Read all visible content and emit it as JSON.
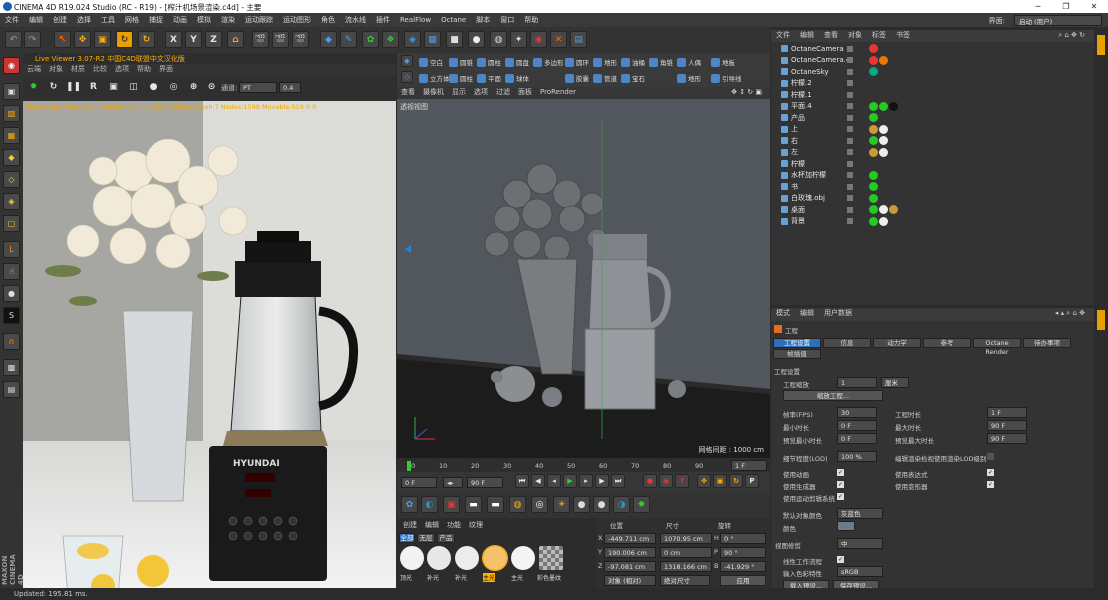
{
  "window": {
    "title": "CINEMA 4D R19.024 Studio (RC - R19) - [榨汁机场景渲染.c4d] - 主要",
    "min": "─",
    "max": "❐",
    "close": "✕"
  },
  "menubar": {
    "items": [
      "文件",
      "编辑",
      "创建",
      "选择",
      "工具",
      "网格",
      "捕捉",
      "动画",
      "模拟",
      "渲染",
      "运动跟踪",
      "运动图形",
      "角色",
      "流水线",
      "插件",
      "RealFlow",
      "Octane",
      "脚本",
      "窗口",
      "帮助"
    ],
    "layout_label": "界面:",
    "layout_value": "启动 (用户)"
  },
  "toolbar": {
    "axes": [
      "X",
      "Y",
      "Z"
    ]
  },
  "live_viewer": {
    "title": "Live Viewer 3.07-R2 中国C4D联盟中文汉化版",
    "menu": [
      "云端",
      "对象",
      "材质",
      "比较",
      "选项",
      "帮助",
      "界面"
    ],
    "channel_label": "通道:",
    "channel_value": "PT",
    "channel_num": "0.4",
    "check_text": "Check:1ms./4ms. MeshGen:6ms. Update[C]:195ms. Mesh:7 Nodes:1598 Movable:519  0 0"
  },
  "primitives": [
    {
      "label": "空白"
    },
    {
      "label": "圆锥"
    },
    {
      "label": "圆柱"
    },
    {
      "label": "圆盘"
    },
    {
      "label": "多边形"
    },
    {
      "label": "圆环"
    },
    {
      "label": "地形"
    },
    {
      "label": "油桶"
    },
    {
      "label": "角锥"
    },
    {
      "label": "人偶"
    },
    {
      "label": "地板"
    },
    {
      "label": "立方体"
    },
    {
      "label": "圆柱"
    },
    {
      "label": "平面"
    },
    {
      "label": "球体"
    },
    {
      "label": "胶囊"
    },
    {
      "label": "管道"
    },
    {
      "label": "宝石"
    },
    {
      "label": "地形"
    },
    {
      "label": "引导线"
    }
  ],
  "viewport": {
    "menu": [
      "查看",
      "摄像机",
      "显示",
      "选项",
      "过滤",
      "面板",
      "ProRender"
    ],
    "label": "透视视图",
    "grid": "网格间距 : 1000 cm"
  },
  "timeline": {
    "ticks": [
      "0",
      "10",
      "20",
      "30",
      "40",
      "50",
      "60",
      "70",
      "80",
      "90"
    ],
    "frame_end": "1 F"
  },
  "transport": {
    "start": "0 F",
    "current": "0 F",
    "end": "90 F",
    "end2": "90 F"
  },
  "materials": {
    "menu": [
      "创建",
      "编辑",
      "功能",
      "纹理"
    ],
    "filters": [
      "全部",
      "无层",
      "产品"
    ],
    "swatches": [
      {
        "label": "顶光",
        "color": "#f2f2f2"
      },
      {
        "label": "补光",
        "color": "#e8e8e8"
      },
      {
        "label": "补光",
        "color": "#ececec"
      },
      {
        "label": "主光",
        "color": "#f5c16b"
      },
      {
        "label": "主光",
        "color": "#f4f4f4"
      },
      {
        "label": "彩色墨纹",
        "color": "#c8c8c8"
      }
    ]
  },
  "coords": {
    "headers": [
      "位置",
      "尺寸",
      "旋转"
    ],
    "rows": [
      {
        "a": "X",
        "av": "-449.711 cm",
        "b": "1070.95 cm",
        "c": "H",
        "cv": "0 °"
      },
      {
        "a": "Y",
        "av": "190.006 cm",
        "b": "0 cm",
        "c": "P",
        "cv": "90 °"
      },
      {
        "a": "Z",
        "av": "-97.081 cm",
        "b": "1318.166 cm",
        "c": "B",
        "cv": "-41.929 °"
      }
    ],
    "mode1": "对象 (相对)",
    "mode2": "绝对尺寸",
    "apply": "应用"
  },
  "objects": {
    "menu": [
      "文件",
      "编辑",
      "查看",
      "对象",
      "标签",
      "书签"
    ],
    "rows": [
      {
        "name": "OctaneCamera",
        "tags": [
          "#e33"
        ]
      },
      {
        "name": "OctaneCamera.4",
        "tags": [
          "#e33",
          "#e70"
        ]
      },
      {
        "name": "OctaneSky",
        "tags": [
          "#0a8"
        ]
      },
      {
        "name": "柠檬.2",
        "tags": []
      },
      {
        "name": "柠檬.1",
        "tags": []
      },
      {
        "name": "平面.4",
        "tags": [
          "#2c2",
          "#2c2",
          "#111"
        ]
      },
      {
        "name": "产品",
        "tags": [
          "#2c2"
        ]
      },
      {
        "name": "上",
        "tags": [
          "#c93",
          "#eee"
        ]
      },
      {
        "name": "右",
        "tags": [
          "#2c2",
          "#eee"
        ]
      },
      {
        "name": "左",
        "tags": [
          "#c93",
          "#eee"
        ]
      },
      {
        "name": "柠檬",
        "tags": []
      },
      {
        "name": "水杯加柠檬",
        "tags": [
          "#2c2"
        ]
      },
      {
        "name": "书",
        "tags": [
          "#2c2"
        ]
      },
      {
        "name": "白玫瑰.obj",
        "tags": [
          "#2c2"
        ]
      },
      {
        "name": "桌面",
        "tags": [
          "#2c2",
          "#eee",
          "#c93"
        ]
      },
      {
        "name": "背景",
        "tags": [
          "#2c2",
          "#eee"
        ]
      }
    ]
  },
  "attributes": {
    "menu": [
      "模式",
      "编辑",
      "用户数据"
    ],
    "title": "工程",
    "tabs": [
      "工程设置",
      "信息",
      "动力学",
      "参考",
      "Octane Render",
      "待办事项",
      "帧插值"
    ],
    "section": "工程设置",
    "scale_label": "工程缩放",
    "scale_value": "1",
    "scale_unit": "厘米",
    "scale_btn": "缩放工程...",
    "fps_label": "帧率(FPS)",
    "fps": "30",
    "len_label": "工程时长",
    "len": "1 F",
    "min_label": "最小时长",
    "min": "0 F",
    "max_label": "最大时长",
    "max": "90 F",
    "pmin_label": "预览最小时长",
    "pmin": "0 F",
    "pmax_label": "预览最大时长",
    "pmax": "90 F",
    "lod_label": "细节程度(LOD)",
    "lod": "100 %",
    "lod_note": "编辑渲染检视使用渲染LOD级别",
    "anim": "使用动画",
    "expr": "使用表达式",
    "gen": "使用生成器",
    "deform": "使用变形器",
    "mograph": "使用运动剪辑系统",
    "objcolor_label": "默认对象颜色",
    "objcolor": "灰蓝色",
    "color_label": "颜色",
    "vcorr_label": "视图修剪",
    "vcorr": "中",
    "linear": "线性工作流程",
    "incolor_label": "输入色彩特性",
    "incolor": "sRGB",
    "load": "载入预设...",
    "save": "保存预设..."
  },
  "status": "Updated: 195.81 ms.",
  "maxon": "MAXON CINEMA 4D"
}
